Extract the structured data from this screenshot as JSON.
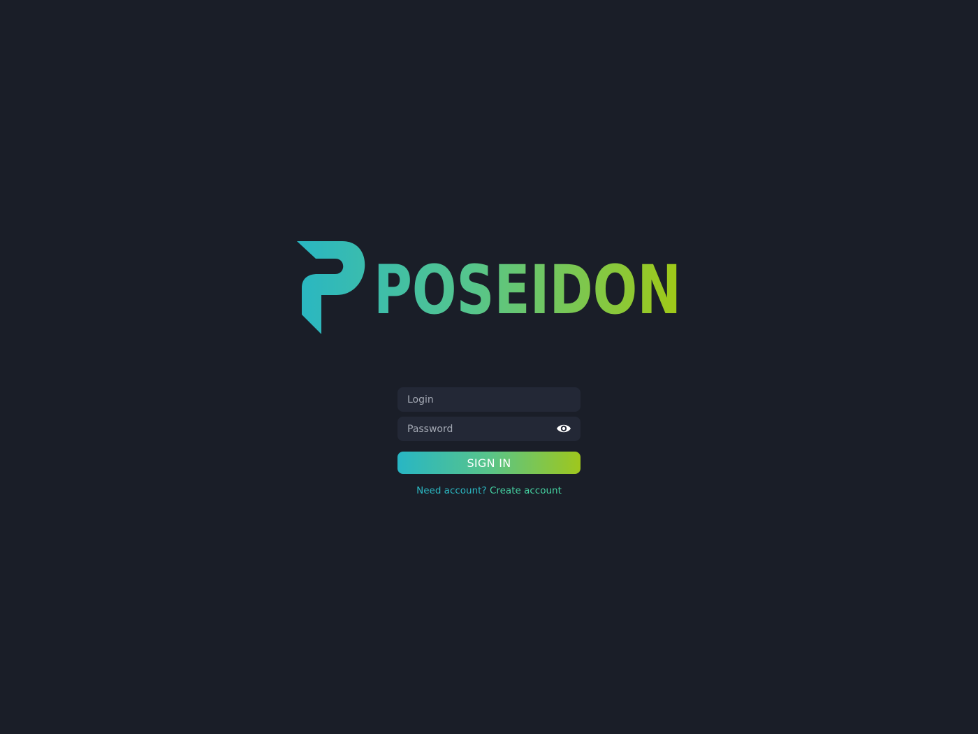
{
  "logo": {
    "text": "POSEIDON",
    "gradient_start": "#28b6c4",
    "gradient_end": "#a2c914"
  },
  "form": {
    "login_placeholder": "Login",
    "password_placeholder": "Password",
    "password_toggle_icon": "eye-icon",
    "signin_label": "SIGN IN",
    "need_account_text": "Need account?",
    "create_account_link": "Create account"
  },
  "colors": {
    "background": "#1a1e28",
    "field_background": "#232836",
    "button_gradient": [
      "#28b6c4",
      "#58c48a",
      "#9fc71d"
    ],
    "need_text": "#2bb8c2",
    "link": "#45d3a2"
  }
}
